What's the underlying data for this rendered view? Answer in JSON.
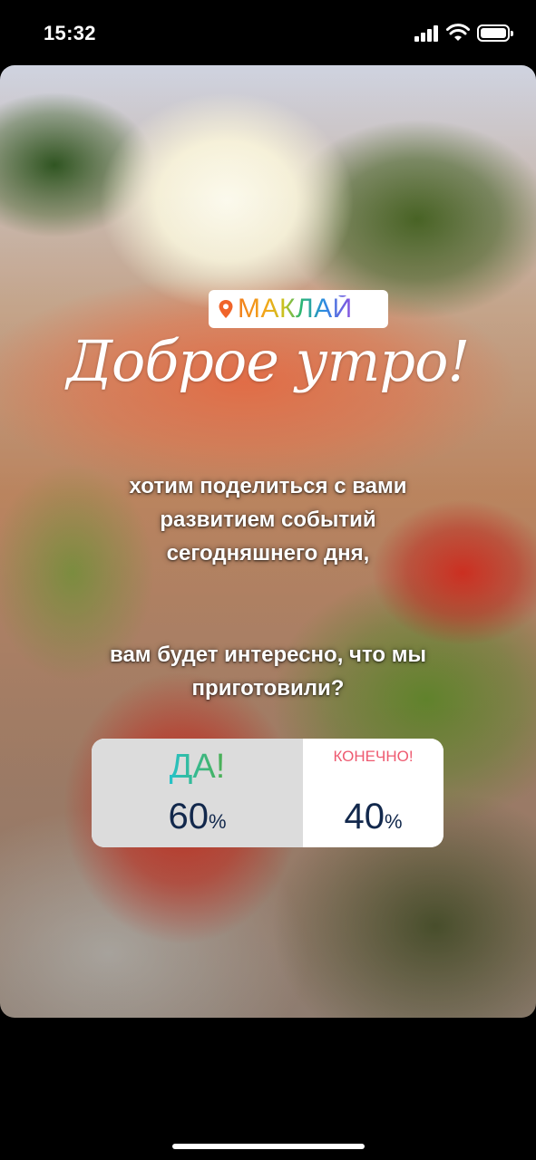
{
  "status_bar": {
    "time": "15:32",
    "icons": [
      "cellular-signal-icon",
      "wifi-icon",
      "battery-icon"
    ]
  },
  "story": {
    "location_sticker": {
      "icon": "location-pin-icon",
      "label": "МАКЛАЙ"
    },
    "greeting": "Доброе утро!",
    "caption_lines_1": [
      "хотим поделиться с вами",
      "развитием событий",
      "сегодняшнего дня,"
    ],
    "caption_lines_2": [
      "вам будет интересно, что мы",
      "приготовили?"
    ],
    "poll": {
      "option_a": {
        "label": "ДА!",
        "percent": "60",
        "unit": "%",
        "share": 0.6
      },
      "option_b": {
        "label": "КОНЕЧНО!",
        "percent": "40",
        "unit": "%",
        "share": 0.4
      }
    }
  },
  "colors": {
    "poll_selected_bg": "#dcdcdc",
    "poll_percent_text": "#12284c",
    "poll_option_b_text": "#ee5a70"
  }
}
